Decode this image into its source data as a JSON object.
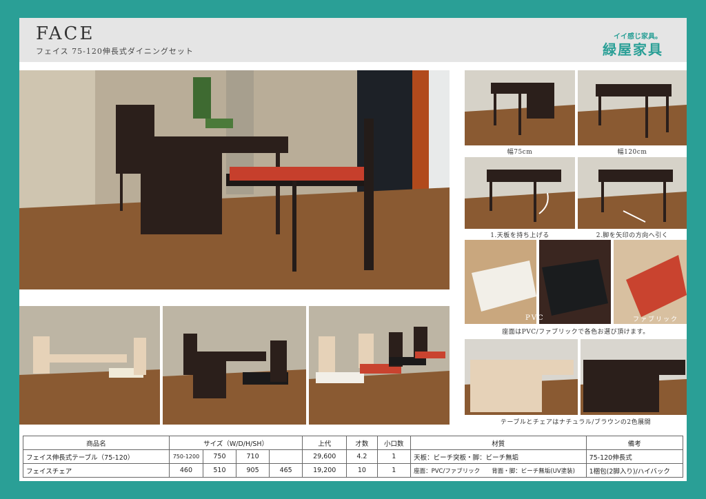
{
  "header": {
    "title": "FACE",
    "subtitle": "フェイス 75-120伸長式ダイニングセット",
    "brand_tagline": "イイ感じ家具。",
    "brand_name": "緑屋家具"
  },
  "captions": {
    "width75": "幅75cm",
    "width120": "幅120cm",
    "step1": "1.天板を持ち上げる",
    "step2": "2.脚を矢印の方向へ引く",
    "pvc_label": "PVC",
    "fabric_label": "ファブリック",
    "seat_note": "座面はPVC/ファブリックで各色お選び頂けます。",
    "color_note": "テーブルとチェアはナチュラル/ブラウンの2色展開"
  },
  "colors": {
    "frame": "#2a9f96",
    "dark_wood": "#2b1f1b",
    "natural_wood": "#e6d2b8",
    "red_seat": "#c9432f",
    "floor": "#8a5a32"
  },
  "spec_table": {
    "headers": {
      "name": "商品名",
      "size": "サイズ（W/D/H/SH）",
      "price": "上代",
      "volume": "才数",
      "pieces": "小口数",
      "material": "材質",
      "note": "備考"
    },
    "rows": [
      {
        "name": "フェイス伸長式テーブル（75-120）",
        "w": "750-1200",
        "d": "750",
        "h": "710",
        "sh": "",
        "price": "29,600",
        "volume": "4.2",
        "pieces": "1",
        "material": "天板：ビーチ突板・脚：ビーチ無垢",
        "note": "75-120伸長式"
      },
      {
        "name": "フェイスチェア",
        "w": "460",
        "d": "510",
        "h": "905",
        "sh": "465",
        "price": "19,200",
        "volume": "10",
        "pieces": "1",
        "material": "座面：PVC/ファブリック　　背面・脚：ビーチ無垢(UV塗装)",
        "note": "1梱包(2脚入り)/ハイバック"
      }
    ]
  }
}
